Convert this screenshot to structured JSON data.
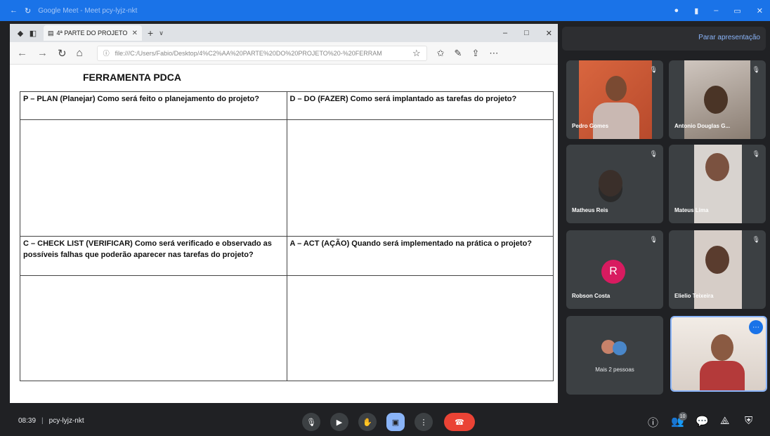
{
  "outer_bar": {
    "title": "Google Meet - Meet pcy-lyjz-nkt",
    "color": "#1a73e8"
  },
  "browser": {
    "tab_label": "4ª PARTE DO PROJETO",
    "url": "file:///C:/Users/Fabio/Desktop/4%C2%AA%20PARTE%20DO%20PROJETO%20-%20FERRAM"
  },
  "document": {
    "title": "FERRAMENTA PDCA",
    "plan": "P – PLAN (Planejar) Como será feito o planejamento do projeto?",
    "do": "D – DO (FAZER) Como será implantado as tarefas do projeto?",
    "check": "C – CHECK LIST (VERIFICAR) Como será verificado e observado as possíveis falhas que poderão aparecer nas tarefas do projeto?",
    "act": "A – ACT (AÇÃO) Quando será implementado na prática o projeto?"
  },
  "sidebar": {
    "stop_presenting": "Parar apresentação"
  },
  "participants": [
    {
      "name": "Pedro Gomes"
    },
    {
      "name": "Antonio Douglas G..."
    },
    {
      "name": "Matheus Reis"
    },
    {
      "name": "Mateus Lima"
    },
    {
      "name": "Robson Costa",
      "initial": "R",
      "avatar_color": "#d81b60"
    },
    {
      "name": "Elielio Teixeira"
    }
  ],
  "more_people": "Mais 2 pessoas",
  "meeting": {
    "time": "08:39",
    "code": "pcy-lyjz-nkt",
    "people_count": "10"
  },
  "icons": [
    "mic-icon",
    "camera-icon",
    "hand-icon",
    "present-icon",
    "more-icon",
    "hangup-icon",
    "info-icon",
    "people-icon",
    "chat-icon",
    "activities-icon",
    "shield-icon"
  ],
  "colors": {
    "meet_bg": "#202124",
    "tile_bg": "#3c4043",
    "hangup": "#ea4335",
    "present_active": "#8ab4f8"
  }
}
